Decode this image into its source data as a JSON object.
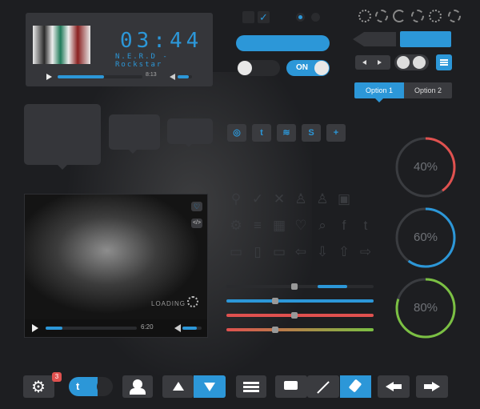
{
  "player": {
    "time": "03:44",
    "track": "N.E.R.D - Rockstar",
    "position": "8:13",
    "progress": 0.55,
    "volume": 0.8
  },
  "switches": {
    "on_label": "ON",
    "checkbox_checked": true,
    "radio_selected": 0
  },
  "segmented": {
    "option1": "Option 1",
    "option2": "Option 2",
    "selected": 0
  },
  "social": [
    "dribbble-icon",
    "twitter-icon",
    "rss-icon",
    "skype-icon",
    "plus-icon"
  ],
  "gauges": [
    {
      "label": "40%",
      "value": 40,
      "color": "#e0514f"
    },
    {
      "label": "60%",
      "value": 60,
      "color": "#2c97d8"
    },
    {
      "label": "80%",
      "value": 80,
      "color": "#7bc043"
    }
  ],
  "video": {
    "loading_label": "LOADING",
    "time": "6:20",
    "progress": 0.18,
    "volume": 0.75
  },
  "sliders": [
    {
      "color": "#2c97d8",
      "value": 0.44
    },
    {
      "color": "#2c97d8",
      "value": 0.31
    },
    {
      "color": "#e0514f",
      "value": 0.44
    },
    {
      "color": "#7bc043",
      "value": 0.31
    }
  ],
  "toolbar": {
    "badge_count": "3"
  },
  "colors": {
    "accent": "#2c97d8",
    "red": "#e0514f",
    "green": "#7bc043",
    "panel": "#35363a"
  }
}
